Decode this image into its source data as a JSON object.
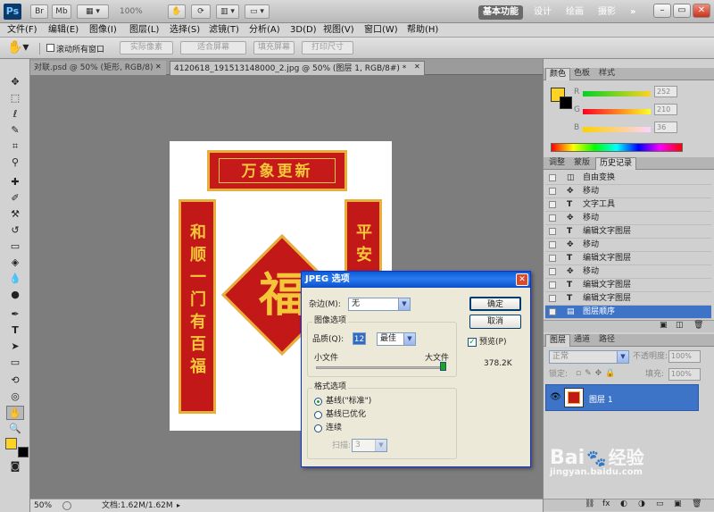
{
  "app": {
    "logo": "Ps"
  },
  "titlebar": {
    "buttons": [
      "Br",
      "Mb"
    ],
    "zoom": "100%",
    "workspaces": [
      "基本功能",
      "设计",
      "绘画",
      "摄影"
    ],
    "more": "»"
  },
  "menu": [
    "文件(F)",
    "编辑(E)",
    "图像(I)",
    "图层(L)",
    "选择(S)",
    "滤镜(T)",
    "分析(A)",
    "3D(D)",
    "视图(V)",
    "窗口(W)",
    "帮助(H)"
  ],
  "options": {
    "scroll_all": "滚动所有窗口",
    "buttons": [
      "实际像素",
      "适合屏幕",
      "填充屏幕",
      "打印尺寸"
    ]
  },
  "doc_tabs": [
    {
      "label": "对联.psd @ 50% (矩形, RGB/8)",
      "active": false
    },
    {
      "label": "4120618_191513148000_2.jpg @ 50% (图层 1, RGB/8#) *",
      "active": true
    }
  ],
  "artwork": {
    "banner": "万象更新",
    "left_couplet": "和顺一门有百福",
    "right_couplet": "平安",
    "diamond": "福"
  },
  "status": {
    "zoom": "50%",
    "doc": "文档:1.62M/1.62M"
  },
  "color_panel": {
    "tabs": [
      "颜色",
      "色板",
      "样式"
    ],
    "channels": [
      {
        "name": "R",
        "value": "252"
      },
      {
        "name": "G",
        "value": "210"
      },
      {
        "name": "B",
        "value": "36"
      }
    ],
    "foreground": "#fcd224"
  },
  "history_panel": {
    "tabs": [
      "调整",
      "蒙版",
      "历史记录"
    ],
    "items": [
      "自由变换",
      "移动",
      "文字工具",
      "移动",
      "编辑文字图层",
      "移动",
      "编辑文字图层",
      "移动",
      "编辑文字图层",
      "编辑文字图层",
      "图层顺序"
    ],
    "selected_index": 10
  },
  "layers_panel": {
    "tabs": [
      "图层",
      "通道",
      "路径"
    ],
    "blend_mode": "正常",
    "opacity_label": "不透明度:",
    "opacity": "100%",
    "lock_label": "锁定:",
    "fill_label": "填充:",
    "fill": "100%",
    "layers": [
      {
        "name": "图层 1"
      }
    ]
  },
  "dialog": {
    "title": "JPEG 选项",
    "matte_label": "杂边(M):",
    "matte_value": "无",
    "ok": "确定",
    "cancel": "取消",
    "preview_label": "预览(P)",
    "preview_checked": true,
    "file_size": "378.2K",
    "image_options_title": "图像选项",
    "quality_label": "品质(Q):",
    "quality_value": "12",
    "quality_preset": "最佳",
    "quality_fraction": 1.0,
    "small_file": "小文件",
    "large_file": "大文件",
    "format_title": "格式选项",
    "formats": [
      "基线(\"标准\")",
      "基线已优化",
      "连续"
    ],
    "selected_format": 0,
    "scans_label": "扫描:",
    "scans_value": "3"
  },
  "watermark": {
    "brand": "Bai",
    "brand2": "经验",
    "url": "jingyan.baidu.com"
  }
}
